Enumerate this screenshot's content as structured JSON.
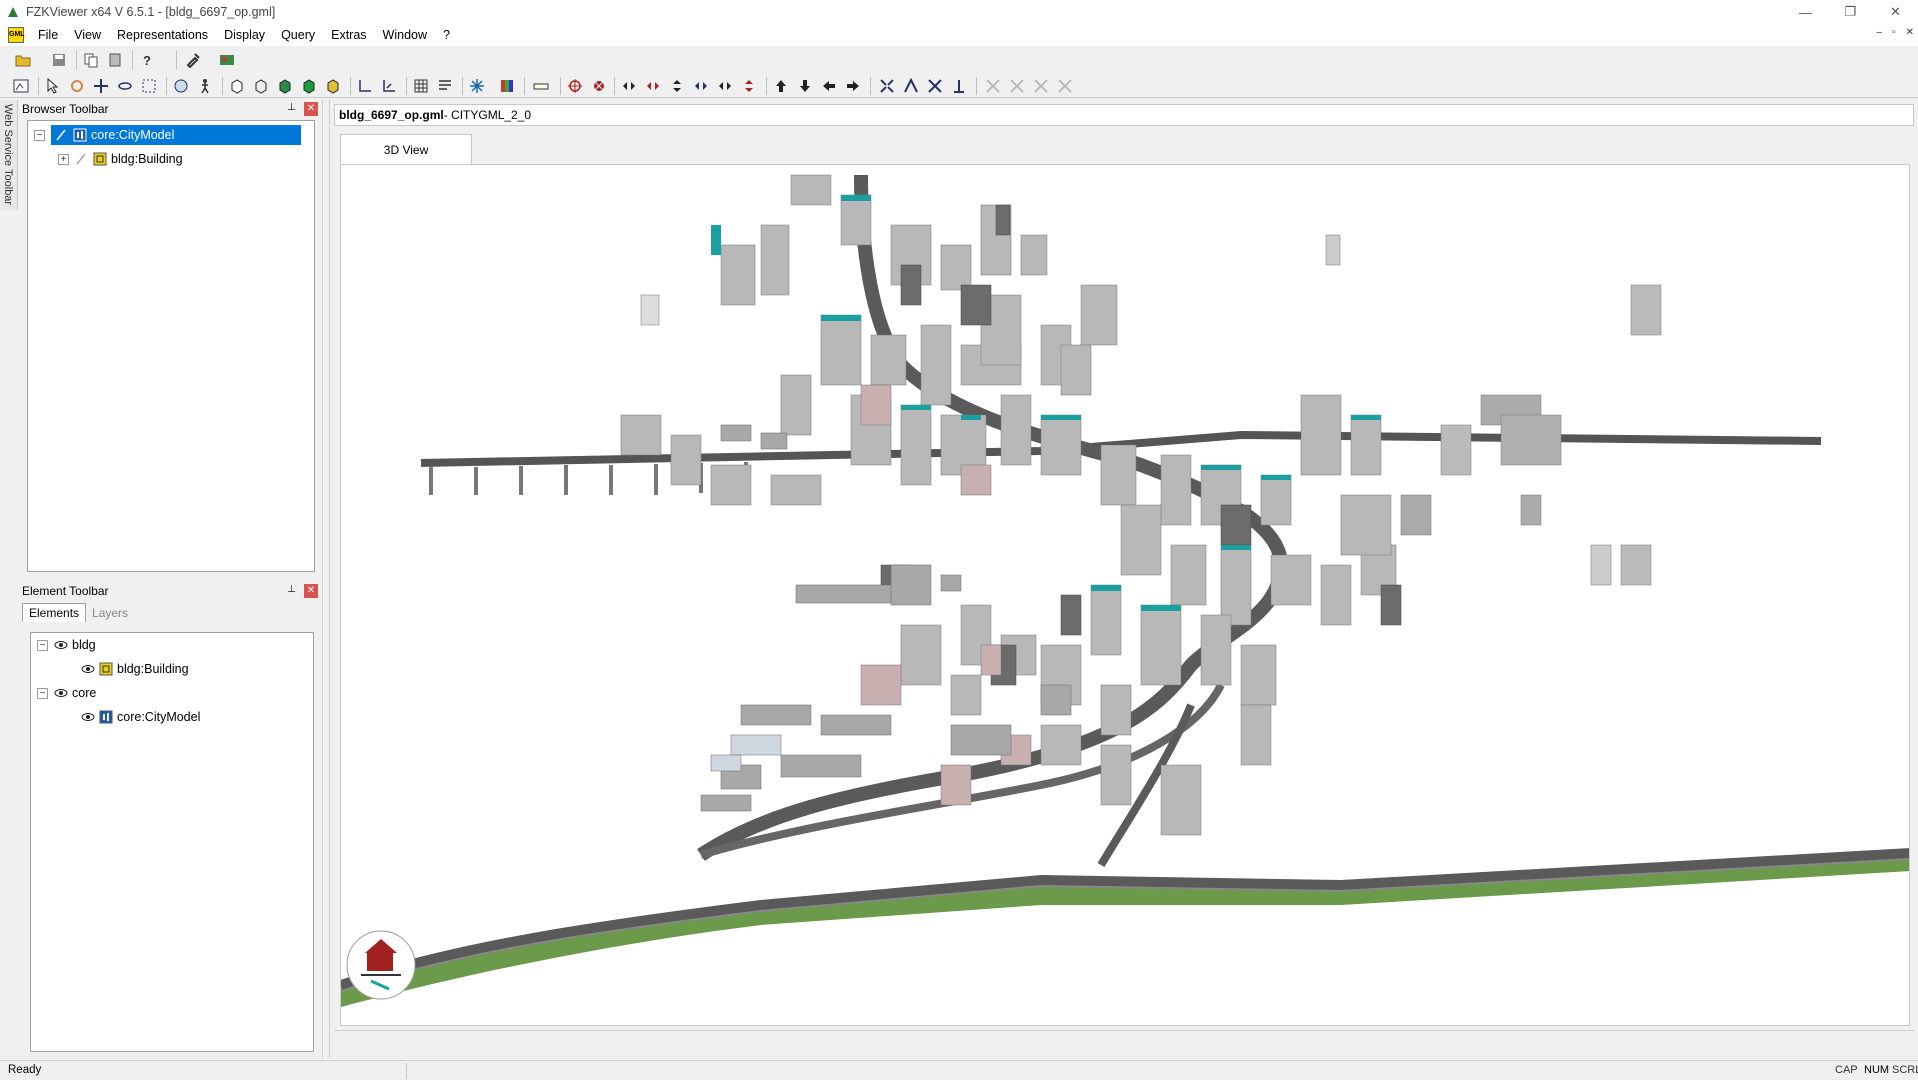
{
  "window": {
    "title": "FZKViewer x64 V 6.5.1 - [bldg_6697_op.gml]",
    "minimize_glyph": "—",
    "maximize_glyph": "❐",
    "close_glyph": "✕"
  },
  "menu": {
    "items": [
      "File",
      "View",
      "Representations",
      "Display",
      "Query",
      "Extras",
      "Window",
      "?"
    ],
    "app_icon_text": "GML",
    "mdi_minimize": "–",
    "mdi_restore": "▫",
    "mdi_close": "✕"
  },
  "left_tab": {
    "label": "Web Service Toolbar"
  },
  "browser_panel": {
    "title": "Browser Toolbar",
    "pin_glyph": "📌",
    "close_glyph": "✕",
    "tree": [
      {
        "label": "core:CityModel",
        "expander": "−",
        "selected": true
      },
      {
        "label": "bldg:Building",
        "expander": "+",
        "selected": false
      }
    ]
  },
  "element_panel": {
    "title": "Element Toolbar",
    "pin_glyph": "📌",
    "close_glyph": "✕",
    "tabs": [
      "Elements",
      "Layers"
    ],
    "tree": [
      {
        "label": "bldg",
        "expander": "−"
      },
      {
        "label": "bldg:Building"
      },
      {
        "label": "core",
        "expander": "−"
      },
      {
        "label": "core:CityModel"
      }
    ]
  },
  "document": {
    "filename": "bldg_6697_op.gml",
    "suffix": " - CITYGML_2_0",
    "view_tab": "3D View"
  },
  "status": {
    "text": "Ready",
    "indicators": [
      "CAP",
      "NUM",
      "SCRL"
    ]
  },
  "colors": {
    "selection": "#0078d7",
    "road": "#5a5a5a",
    "grass": "#6a9a4a",
    "teal_roof": "#1aa0a0"
  }
}
